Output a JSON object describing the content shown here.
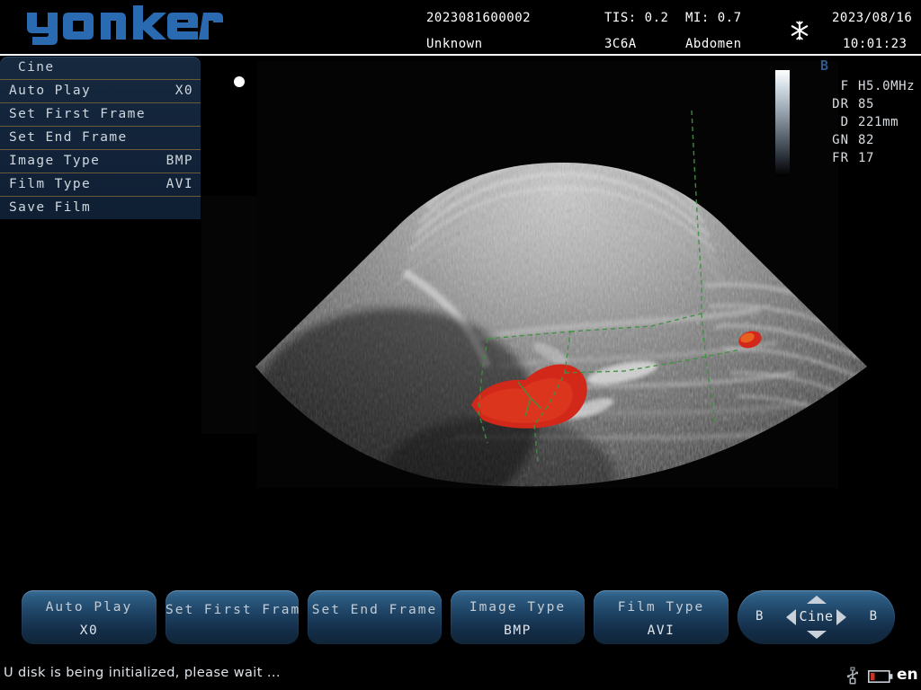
{
  "header": {
    "logo_text": "yonker",
    "logo_color": "#2a6ab0",
    "patient_id": "2023081600002",
    "patient_name": "Unknown",
    "tis": "TIS: 0.2",
    "mi": "MI: 0.7",
    "probe": "3C6A",
    "exam_type": "Abdomen",
    "date": "2023/08/16",
    "time": "10:01:23",
    "freeze_icon": "snowflake-icon"
  },
  "cine_menu": {
    "title": "Cine",
    "items": [
      {
        "label": "Auto Play",
        "value": "X0"
      },
      {
        "label": "Set First Frame",
        "value": ""
      },
      {
        "label": "Set End Frame",
        "value": ""
      },
      {
        "label": "Image Type",
        "value": "BMP"
      },
      {
        "label": "Film Type",
        "value": "AVI"
      },
      {
        "label": "Save Film",
        "value": ""
      }
    ]
  },
  "scan": {
    "orientation_marker": "orientation-dot",
    "grayscale_bar": "grayscale-ramp",
    "doppler_color": "#d1281a",
    "trace_color": "#3f9140",
    "image_kind": "abdominal-sector-ultrasound-with-color-doppler"
  },
  "params": {
    "mode": "B",
    "mode_color": "#2d5a8a",
    "rows": [
      {
        "key": "F",
        "value": "H5.0MHz"
      },
      {
        "key": "DR",
        "value": "85"
      },
      {
        "key": "D",
        "value": "221mm"
      },
      {
        "key": "GN",
        "value": "82"
      },
      {
        "key": "FR",
        "value": "17"
      }
    ]
  },
  "softkeys": [
    {
      "line1": "Auto Play",
      "line2": "X0"
    },
    {
      "line1": "Set First Frame",
      "line2": ""
    },
    {
      "line1": "Set End Frame",
      "line2": ""
    },
    {
      "line1": "Image Type",
      "line2": "BMP"
    },
    {
      "line1": "Film Type",
      "line2": "AVI"
    }
  ],
  "nav_key": {
    "left_label": "B",
    "right_label": "B",
    "center_label": "Cine"
  },
  "status": {
    "message": "U disk is being initialized, please wait ...",
    "usb_icon": "usb-icon",
    "battery_icon": "battery-icon",
    "battery_color": "#c8321e",
    "language": "en"
  }
}
